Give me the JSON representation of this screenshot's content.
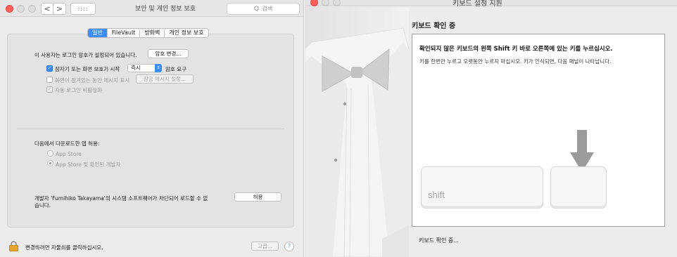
{
  "left_window": {
    "title": "보안 및 개인 정보 보호",
    "search_placeholder": "검색",
    "search_icon_glyph": "Q",
    "back_glyph": "<",
    "forward_glyph": ">",
    "grid_glyph": "::::",
    "tabs": [
      {
        "label": "일반",
        "active": true
      },
      {
        "label": "FileVault",
        "active": false
      },
      {
        "label": "방화벽",
        "active": false
      },
      {
        "label": "개인 정보 보호",
        "active": false
      }
    ],
    "password_set_text": "이 사용자는 로그인 암호가 설정되어 있습니다.",
    "change_password_button": "암호 변경...",
    "require_password": {
      "checked": true,
      "label_before": "잠자기 또는 화면 보호기 시작",
      "select_value": "즉시",
      "label_after": "암호 요구"
    },
    "show_message": {
      "checked": false,
      "label": "화면이 잠겨있는 동안 메시지 표시",
      "button": "잠금 메시지 설정..."
    },
    "disable_autologin": {
      "checked": true,
      "label": "자동 로그인 비활성화"
    },
    "allow_apps_label": "다음에서 다운로드한 앱 허용:",
    "radio_options": [
      {
        "label": "App Store",
        "selected": false
      },
      {
        "label": "App Store 및 확인된 개발자",
        "selected": true
      }
    ],
    "blocked_line1": "개발자 'Fumihiko Takayama'의 시스템 소프트웨어가 차단되어 로드할 수 없",
    "blocked_line2": "습니다.",
    "allow_button": "허용",
    "lock_text": "변경하려면 자물쇠를 클릭하십시오.",
    "advanced_button": "고급...",
    "help_glyph": "?"
  },
  "right_window": {
    "title": "키보드 설정 지원",
    "heading": "키보드 확인 중",
    "instruction_bold": "확인되지 않은 키보드의 왼쪽 Shift 키 바로 오른쪽에 있는 키를 누르십시오.",
    "instruction_sub": "키를 한번만 누르고 오랫동안 누르지 마십시오. 키가 인식되면, 다음 패널이 나타납니다.",
    "shift_key_label": "shift",
    "status_text": "키보드 확인 중..."
  },
  "colors": {
    "accent": "#3b8ef5",
    "close_red": "#fc5f57"
  }
}
